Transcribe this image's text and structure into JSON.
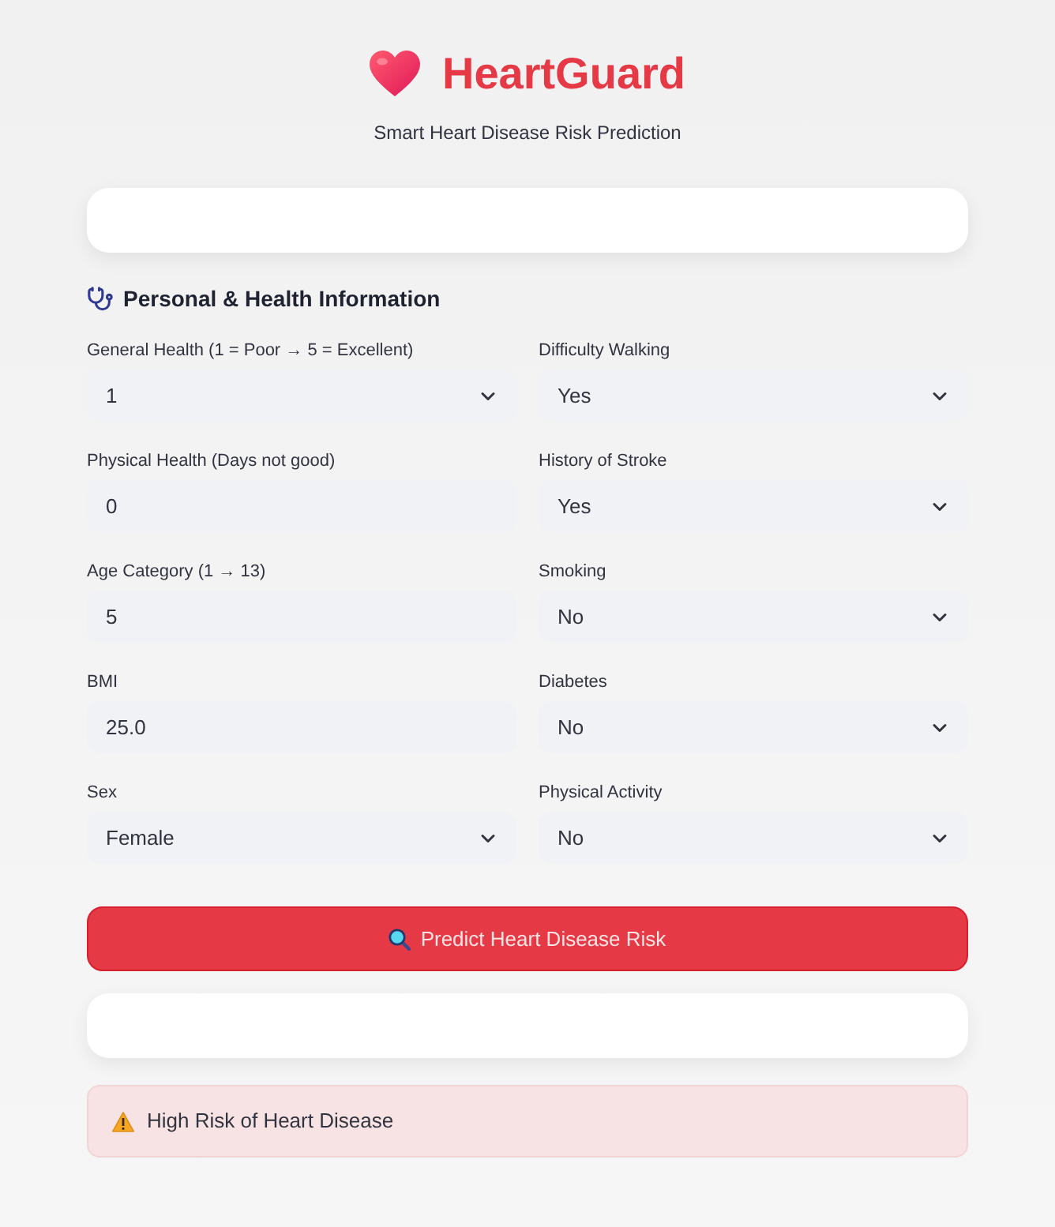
{
  "header": {
    "title": "HeartGuard",
    "subtitle": "Smart Heart Disease Risk Prediction"
  },
  "section": {
    "title": "Personal & Health Information"
  },
  "form": {
    "left": [
      {
        "label": "General Health (1 = Poor → 5 = Excellent)",
        "kind": "select",
        "value": "1"
      },
      {
        "label": "Physical Health (Days not good)",
        "kind": "number",
        "value": "0"
      },
      {
        "label": "Age Category (1 → 13)",
        "kind": "number",
        "value": "5"
      },
      {
        "label": "BMI",
        "kind": "number",
        "value": "25.0"
      },
      {
        "label": "Sex",
        "kind": "select",
        "value": "Female"
      }
    ],
    "right": [
      {
        "label": "Difficulty Walking",
        "kind": "select",
        "value": "Yes"
      },
      {
        "label": "History of Stroke",
        "kind": "select",
        "value": "Yes"
      },
      {
        "label": "Smoking",
        "kind": "select",
        "value": "No"
      },
      {
        "label": "Diabetes",
        "kind": "select",
        "value": "No"
      },
      {
        "label": "Physical Activity",
        "kind": "select",
        "value": "No"
      }
    ]
  },
  "predict_button": {
    "label": "Predict Heart Disease Risk"
  },
  "result": {
    "kind": "warning",
    "text": "High Risk of Heart Disease"
  }
}
